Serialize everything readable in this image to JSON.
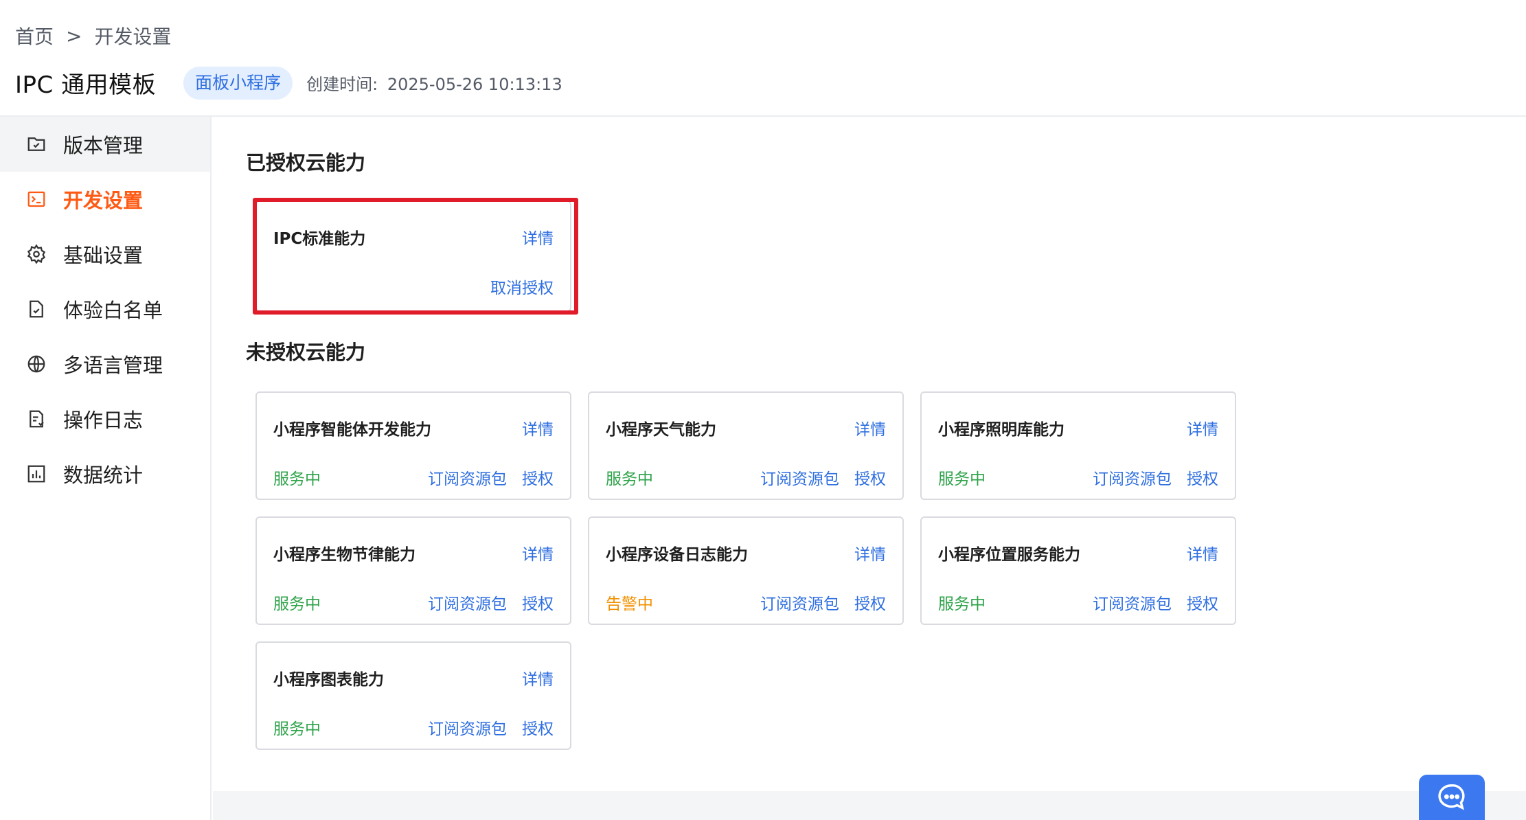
{
  "breadcrumb": {
    "home": "首页",
    "separator": ">",
    "current": "开发设置"
  },
  "header": {
    "title": "IPC 通用模板",
    "tag": "面板小程序",
    "created_label": "创建时间:",
    "created_value": "2025-05-26 10:13:13"
  },
  "sidebar": {
    "items": [
      {
        "label": "版本管理",
        "icon": "version-icon"
      },
      {
        "label": "开发设置",
        "icon": "terminal-icon"
      },
      {
        "label": "基础设置",
        "icon": "gear-icon"
      },
      {
        "label": "体验白名单",
        "icon": "whitelist-icon"
      },
      {
        "label": "多语言管理",
        "icon": "globe-icon"
      },
      {
        "label": "操作日志",
        "icon": "log-icon"
      },
      {
        "label": "数据统计",
        "icon": "chart-icon"
      }
    ],
    "active_index": 1
  },
  "authorized": {
    "title": "已授权云能力",
    "cards": [
      {
        "name": "IPC标准能力",
        "detail": "详情",
        "action": "取消授权"
      }
    ]
  },
  "unauthorized": {
    "title": "未授权云能力",
    "cards": [
      {
        "name": "小程序智能体开发能力",
        "detail": "详情",
        "status": "服务中",
        "subscribe": "订阅资源包",
        "authorize": "授权"
      },
      {
        "name": "小程序天气能力",
        "detail": "详情",
        "status": "服务中",
        "subscribe": "订阅资源包",
        "authorize": "授权"
      },
      {
        "name": "小程序照明库能力",
        "detail": "详情",
        "status": "服务中",
        "subscribe": "订阅资源包",
        "authorize": "授权"
      },
      {
        "name": "小程序生物节律能力",
        "detail": "详情",
        "status": "服务中",
        "subscribe": "订阅资源包",
        "authorize": "授权"
      },
      {
        "name": "小程序设备日志能力",
        "detail": "详情",
        "status": "告警中",
        "subscribe": "订阅资源包",
        "authorize": "授权"
      },
      {
        "name": "小程序位置服务能力",
        "detail": "详情",
        "status": "服务中",
        "subscribe": "订阅资源包",
        "authorize": "授权"
      },
      {
        "name": "小程序图表能力",
        "detail": "详情",
        "status": "服务中",
        "subscribe": "订阅资源包",
        "authorize": "授权"
      }
    ]
  },
  "colors": {
    "accent": "#ff5a14",
    "link": "#2f6fe0",
    "status_ok": "#2fa34a",
    "status_warn": "#f29100",
    "highlight": "#e01b2a",
    "chat_button": "#3c78f0"
  },
  "chat_button_icon": "chat-bubble-icon"
}
